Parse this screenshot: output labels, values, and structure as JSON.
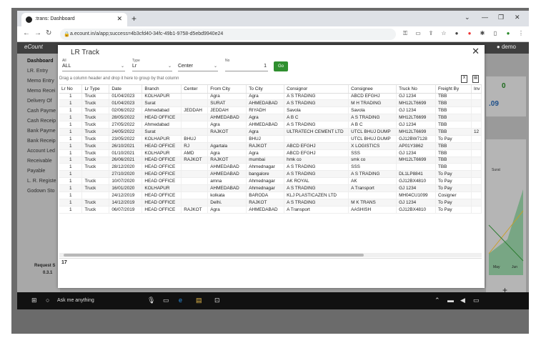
{
  "browser": {
    "tab_title": ":trans: Dashboard",
    "url": "a.ecount.in/a/app;success=4b3cfd40-34fc-49b1-9758-d5ebd9940e24"
  },
  "app": {
    "brand": "eCount",
    "user": "demo",
    "sidebar": [
      "Dashboard",
      "LR. Entry",
      "Memo Entry",
      "Memo Recei",
      "Delivery Of",
      "Cash Payme",
      "Cash Receip",
      "Bank Payme",
      "Bank Receip",
      "Account Led",
      "Receivable",
      "Payable",
      "L. R. Registe",
      "Godown Sto"
    ],
    "request_label": "Request S",
    "version": "0.3.1",
    "right_values": [
      "0",
      ".09"
    ],
    "chart_label": "Surat",
    "chart_months": [
      "May",
      "Jun"
    ],
    "plus_label": "+"
  },
  "taskbar": {
    "search": "Ask me anything"
  },
  "modal": {
    "title": "LR Track",
    "filters": {
      "all_label": "All",
      "all_value": "ALL",
      "type_label": "Type",
      "type_value": "Lr",
      "center_value": "Center",
      "no_label": "No",
      "no_value": "1",
      "go_label": "Go"
    },
    "drag_hint": "Drag a column header and drop it here to group by that column",
    "columns": [
      "Lr No",
      "Lr Type",
      "Date",
      "Branch",
      "Center",
      "From City",
      "To City",
      "Consignor",
      "Consignee",
      "Truck No",
      "Freight By",
      "Inv"
    ],
    "rows": [
      [
        "1",
        "Truck",
        "01/04/2023",
        "KOLHAPUR",
        "",
        "Agra",
        "Agra",
        "A S TRADING",
        "ABCD EFGHJ",
        "GJ 1234",
        "TBB",
        ""
      ],
      [
        "1",
        "Truck",
        "01/04/2023",
        "Surat",
        "",
        "SURAT",
        "AHMEDABAD",
        "A S TRADING",
        "M H TRADING",
        "MH12LT6699",
        "TBB",
        ""
      ],
      [
        "1",
        "Truck",
        "02/06/2022",
        "Ahmedabad",
        "JEDDAH",
        "JEDDAH",
        "RIYADH",
        "Savola",
        "Savola",
        "GJ 1234",
        "TBB",
        ""
      ],
      [
        "1",
        "Truck",
        "28/05/2022",
        "HEAD OFFICE",
        "",
        "AHMEDABAD",
        "Agra",
        "A B C",
        "A S TRADING",
        "MH12LT6699",
        "TBB",
        ""
      ],
      [
        "1",
        "Truck",
        "27/05/2022",
        "Ahmedabad",
        "",
        "Agra",
        "AHMEDABAD",
        "A S TRADING",
        "A B C",
        "GJ 1234",
        "TBB",
        ""
      ],
      [
        "1",
        "Truck",
        "24/05/2022",
        "Surat",
        "",
        "RAJKOT",
        "Agra",
        "ULTRATECH CEMENT LTD",
        "UTCL BHUJ DUMP",
        "MH12LT6699",
        "TBB",
        "12"
      ],
      [
        "1",
        "Truck",
        "23/05/2022",
        "KOLHAPUR",
        "BHUJ",
        "",
        "BHUJ",
        "",
        "UTCL BHUJ DUMP",
        "GJ12BW7128",
        "To Pay",
        ""
      ],
      [
        "1",
        "Truck",
        "26/10/2021",
        "HEAD OFFICE",
        "RJ",
        "Agartala",
        "RAJKOT",
        "ABCD EFGHJ",
        "X LOGISTICS",
        "AP01Y3862",
        "TBB",
        ""
      ],
      [
        "1",
        "Truck",
        "01/10/2021",
        "KOLHAPUR",
        "AMD",
        "Agra",
        "Agra",
        "ABCD EFGHJ",
        "SSS",
        "GJ 1234",
        "TBB",
        ""
      ],
      [
        "1",
        "Truck",
        "26/06/2021",
        "HEAD OFFICE",
        "RAJKOT",
        "RAJKOT",
        "mumbai",
        "hmk co",
        "smk co",
        "MH12LT6699",
        "TBB",
        ""
      ],
      [
        "1",
        "Truck",
        "28/12/2020",
        "HEAD OFFICE",
        "",
        "AHMEDABAD",
        "Ahmednagar",
        "A S TRADING",
        "SSS",
        "",
        "TBB",
        ""
      ],
      [
        "1",
        "",
        "27/10/2020",
        "HEAD OFFICE",
        "",
        "AHMEDABAD",
        "bangalore",
        "A S TRADING",
        "A S TRADING",
        "DL1LP8841",
        "To Pay",
        ""
      ],
      [
        "1",
        "Truck",
        "10/07/2020",
        "HEAD OFFICE",
        "",
        "amna",
        "Ahmednagar",
        "AK ROYAL",
        "AK",
        "GJ12BX4810",
        "To Pay",
        ""
      ],
      [
        "1",
        "Truck",
        "16/01/2020",
        "KOLHAPUR",
        "",
        "AHMEDABAD",
        "Ahmednagar",
        "A S TRADING",
        "A Transport",
        "GJ 1234",
        "To Pay",
        ""
      ],
      [
        "1",
        "",
        "24/12/2019",
        "HEAD OFFICE",
        "",
        "kolkata",
        "BARODA",
        "KLJ PLASTICAZEN LTD",
        "",
        "MH04CU1099",
        "Cosigner",
        ""
      ],
      [
        "1",
        "Truck",
        "14/12/2019",
        "HEAD OFFICE",
        "",
        "Delhi.",
        "RAJKOT",
        "A S TRADING",
        "M K TRANS",
        "GJ 1234",
        "To Pay",
        ""
      ],
      [
        "1",
        "Truck",
        "06/07/2019",
        "HEAD OFFICE",
        "RAJKOT",
        "Agra",
        "AHMEDABAD",
        "A Transport",
        "AASHISH",
        "GJ12BX4810",
        "To Pay",
        ""
      ]
    ],
    "row_count": "17"
  }
}
